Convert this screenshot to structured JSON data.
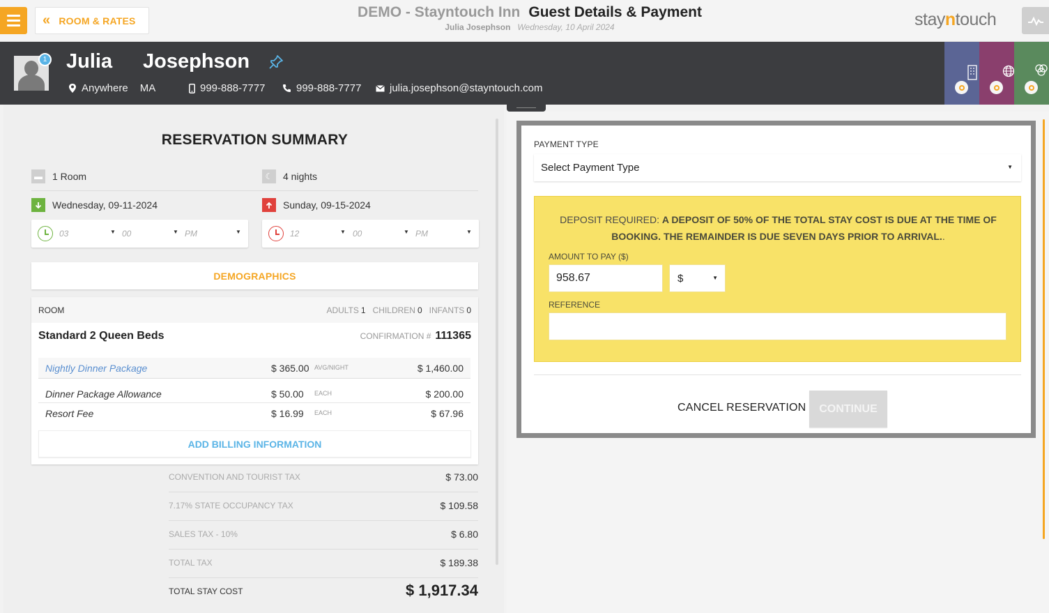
{
  "topbar": {
    "back_label": "ROOM & RATES",
    "hotel_name": "DEMO - Stayntouch Inn",
    "page_title": "Guest Details & Payment",
    "user_name": "Julia Josephson",
    "business_date": "Wednesday, 10 April 2024",
    "logo_pre": "stay",
    "logo_n": "n",
    "logo_post": "touch"
  },
  "guest": {
    "first_name": "Julia",
    "last_name": "Josephson",
    "badge": "1",
    "city": "Anywhere",
    "state": "MA",
    "mobile": "999-888-7777",
    "phone": "999-888-7777",
    "email": "julia.josephson@stayntouch.com",
    "tile_colors": [
      "#5b6595",
      "#8a3f6d",
      "#5a8a5d"
    ]
  },
  "summary": {
    "title": "RESERVATION SUMMARY",
    "rooms": "1 Room",
    "nights": "4 nights",
    "arrival_date": "Wednesday, 09-11-2024",
    "departure_date": "Sunday, 09-15-2024",
    "arrival_time": {
      "hour": "03",
      "minute": "00",
      "ampm": "PM"
    },
    "departure_time": {
      "hour": "12",
      "minute": "00",
      "ampm": "PM"
    },
    "demographics_label": "DEMOGRAPHICS",
    "room_label": "ROOM",
    "adults_label": "ADULTS",
    "adults": "1",
    "children_label": "CHILDREN",
    "children": "0",
    "infants_label": "INFANTS",
    "infants": "0",
    "room_type": "Standard 2 Queen Beds",
    "confirmation_label": "CONFIRMATION #",
    "confirmation_no": "111365",
    "charges": [
      {
        "name": "Nightly Dinner Package",
        "amount": "$ 365.00",
        "unit": "AVG/NIGHT",
        "total": "$ 1,460.00"
      },
      {
        "name": "Dinner Package Allowance",
        "amount": "$ 50.00",
        "unit": "EACH",
        "total": "$ 200.00"
      },
      {
        "name": "Resort Fee",
        "amount": "$ 16.99",
        "unit": "EACH",
        "total": "$ 67.96"
      }
    ],
    "add_billing_label": "ADD BILLING INFORMATION",
    "taxes": [
      {
        "name": "CONVENTION AND TOURIST TAX",
        "value": "$ 73.00"
      },
      {
        "name": "7.17% STATE OCCUPANCY TAX",
        "value": "$ 109.58"
      },
      {
        "name": "SALES TAX - 10%",
        "value": "$ 6.80"
      },
      {
        "name": "TOTAL TAX",
        "value": "$ 189.38"
      },
      {
        "name": "TOTAL STAY COST",
        "value": "$ 1,917.34"
      }
    ]
  },
  "payment": {
    "type_label": "PAYMENT TYPE",
    "type_value": "Select Payment Type",
    "deposit_prefix": "DEPOSIT REQUIRED: ",
    "deposit_text": "A DEPOSIT OF 50% OF THE TOTAL STAY COST IS DUE AT THE TIME OF BOOKING. THE REMAINDER IS DUE SEVEN DAYS PRIOR TO ARRIVAL.",
    "deposit_suffix": ".",
    "amount_label": "AMOUNT TO PAY ($)",
    "amount_value": "958.67",
    "currency": "$",
    "reference_label": "REFERENCE",
    "reference_value": "",
    "cancel_label": "CANCEL RESERVATION",
    "continue_label": "CONTINUE"
  },
  "colors": {
    "accent": "#f5a623",
    "header_bg": "#3c3d40",
    "deposit_bg": "#f8e268",
    "link_blue": "#5ab4e6",
    "arrival_green": "#6db33f",
    "departure_red": "#e0413c"
  }
}
